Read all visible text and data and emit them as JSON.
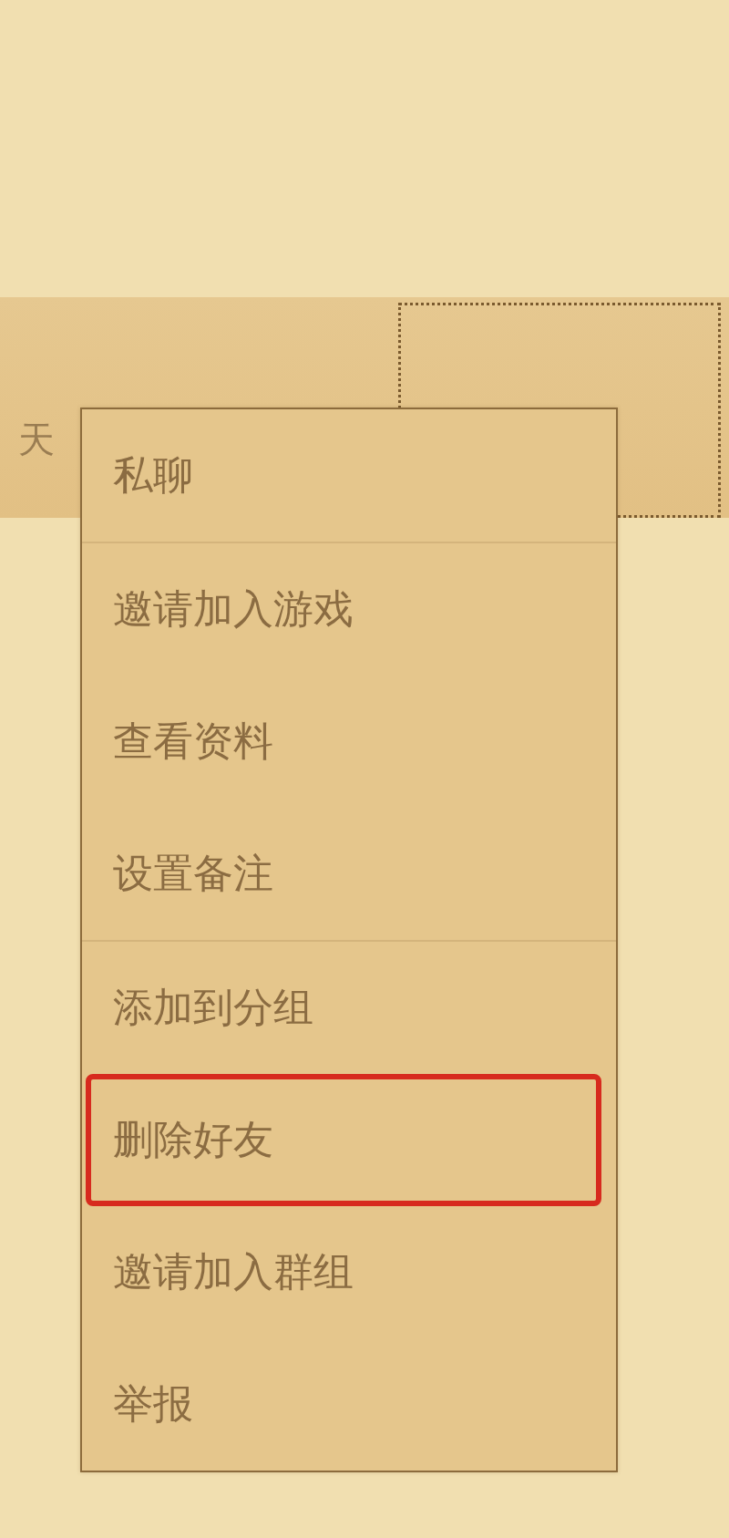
{
  "friend_row": {
    "text": "天",
    "selected": true
  },
  "context_menu": {
    "groups": [
      [
        {
          "label": "私聊",
          "highlighted": false
        }
      ],
      [
        {
          "label": "邀请加入游戏",
          "highlighted": false
        },
        {
          "label": "查看资料",
          "highlighted": false
        },
        {
          "label": "设置备注",
          "highlighted": false
        }
      ],
      [
        {
          "label": "添加到分组",
          "highlighted": false
        },
        {
          "label": "删除好友",
          "highlighted": true
        },
        {
          "label": "邀请加入群组",
          "highlighted": false
        },
        {
          "label": "举报",
          "highlighted": false
        }
      ]
    ]
  }
}
